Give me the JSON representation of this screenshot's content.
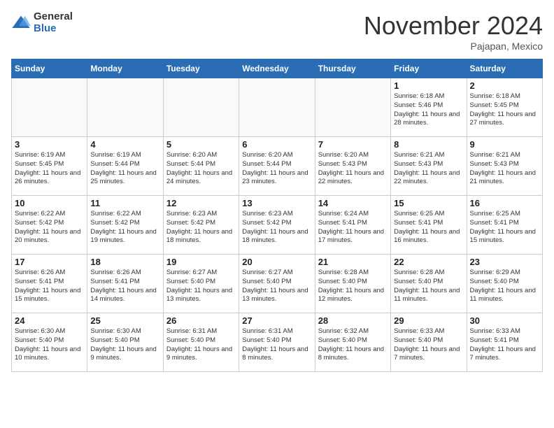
{
  "header": {
    "logo_general": "General",
    "logo_blue": "Blue",
    "month_title": "November 2024",
    "location": "Pajapan, Mexico"
  },
  "weekdays": [
    "Sunday",
    "Monday",
    "Tuesday",
    "Wednesday",
    "Thursday",
    "Friday",
    "Saturday"
  ],
  "weeks": [
    [
      {
        "day": "",
        "sunrise": "",
        "sunset": "",
        "daylight": ""
      },
      {
        "day": "",
        "sunrise": "",
        "sunset": "",
        "daylight": ""
      },
      {
        "day": "",
        "sunrise": "",
        "sunset": "",
        "daylight": ""
      },
      {
        "day": "",
        "sunrise": "",
        "sunset": "",
        "daylight": ""
      },
      {
        "day": "",
        "sunrise": "",
        "sunset": "",
        "daylight": ""
      },
      {
        "day": "1",
        "sunrise": "Sunrise: 6:18 AM",
        "sunset": "Sunset: 5:46 PM",
        "daylight": "Daylight: 11 hours and 28 minutes."
      },
      {
        "day": "2",
        "sunrise": "Sunrise: 6:18 AM",
        "sunset": "Sunset: 5:45 PM",
        "daylight": "Daylight: 11 hours and 27 minutes."
      }
    ],
    [
      {
        "day": "3",
        "sunrise": "Sunrise: 6:19 AM",
        "sunset": "Sunset: 5:45 PM",
        "daylight": "Daylight: 11 hours and 26 minutes."
      },
      {
        "day": "4",
        "sunrise": "Sunrise: 6:19 AM",
        "sunset": "Sunset: 5:44 PM",
        "daylight": "Daylight: 11 hours and 25 minutes."
      },
      {
        "day": "5",
        "sunrise": "Sunrise: 6:20 AM",
        "sunset": "Sunset: 5:44 PM",
        "daylight": "Daylight: 11 hours and 24 minutes."
      },
      {
        "day": "6",
        "sunrise": "Sunrise: 6:20 AM",
        "sunset": "Sunset: 5:44 PM",
        "daylight": "Daylight: 11 hours and 23 minutes."
      },
      {
        "day": "7",
        "sunrise": "Sunrise: 6:20 AM",
        "sunset": "Sunset: 5:43 PM",
        "daylight": "Daylight: 11 hours and 22 minutes."
      },
      {
        "day": "8",
        "sunrise": "Sunrise: 6:21 AM",
        "sunset": "Sunset: 5:43 PM",
        "daylight": "Daylight: 11 hours and 22 minutes."
      },
      {
        "day": "9",
        "sunrise": "Sunrise: 6:21 AM",
        "sunset": "Sunset: 5:43 PM",
        "daylight": "Daylight: 11 hours and 21 minutes."
      }
    ],
    [
      {
        "day": "10",
        "sunrise": "Sunrise: 6:22 AM",
        "sunset": "Sunset: 5:42 PM",
        "daylight": "Daylight: 11 hours and 20 minutes."
      },
      {
        "day": "11",
        "sunrise": "Sunrise: 6:22 AM",
        "sunset": "Sunset: 5:42 PM",
        "daylight": "Daylight: 11 hours and 19 minutes."
      },
      {
        "day": "12",
        "sunrise": "Sunrise: 6:23 AM",
        "sunset": "Sunset: 5:42 PM",
        "daylight": "Daylight: 11 hours and 18 minutes."
      },
      {
        "day": "13",
        "sunrise": "Sunrise: 6:23 AM",
        "sunset": "Sunset: 5:42 PM",
        "daylight": "Daylight: 11 hours and 18 minutes."
      },
      {
        "day": "14",
        "sunrise": "Sunrise: 6:24 AM",
        "sunset": "Sunset: 5:41 PM",
        "daylight": "Daylight: 11 hours and 17 minutes."
      },
      {
        "day": "15",
        "sunrise": "Sunrise: 6:25 AM",
        "sunset": "Sunset: 5:41 PM",
        "daylight": "Daylight: 11 hours and 16 minutes."
      },
      {
        "day": "16",
        "sunrise": "Sunrise: 6:25 AM",
        "sunset": "Sunset: 5:41 PM",
        "daylight": "Daylight: 11 hours and 15 minutes."
      }
    ],
    [
      {
        "day": "17",
        "sunrise": "Sunrise: 6:26 AM",
        "sunset": "Sunset: 5:41 PM",
        "daylight": "Daylight: 11 hours and 15 minutes."
      },
      {
        "day": "18",
        "sunrise": "Sunrise: 6:26 AM",
        "sunset": "Sunset: 5:41 PM",
        "daylight": "Daylight: 11 hours and 14 minutes."
      },
      {
        "day": "19",
        "sunrise": "Sunrise: 6:27 AM",
        "sunset": "Sunset: 5:40 PM",
        "daylight": "Daylight: 11 hours and 13 minutes."
      },
      {
        "day": "20",
        "sunrise": "Sunrise: 6:27 AM",
        "sunset": "Sunset: 5:40 PM",
        "daylight": "Daylight: 11 hours and 13 minutes."
      },
      {
        "day": "21",
        "sunrise": "Sunrise: 6:28 AM",
        "sunset": "Sunset: 5:40 PM",
        "daylight": "Daylight: 11 hours and 12 minutes."
      },
      {
        "day": "22",
        "sunrise": "Sunrise: 6:28 AM",
        "sunset": "Sunset: 5:40 PM",
        "daylight": "Daylight: 11 hours and 11 minutes."
      },
      {
        "day": "23",
        "sunrise": "Sunrise: 6:29 AM",
        "sunset": "Sunset: 5:40 PM",
        "daylight": "Daylight: 11 hours and 11 minutes."
      }
    ],
    [
      {
        "day": "24",
        "sunrise": "Sunrise: 6:30 AM",
        "sunset": "Sunset: 5:40 PM",
        "daylight": "Daylight: 11 hours and 10 minutes."
      },
      {
        "day": "25",
        "sunrise": "Sunrise: 6:30 AM",
        "sunset": "Sunset: 5:40 PM",
        "daylight": "Daylight: 11 hours and 9 minutes."
      },
      {
        "day": "26",
        "sunrise": "Sunrise: 6:31 AM",
        "sunset": "Sunset: 5:40 PM",
        "daylight": "Daylight: 11 hours and 9 minutes."
      },
      {
        "day": "27",
        "sunrise": "Sunrise: 6:31 AM",
        "sunset": "Sunset: 5:40 PM",
        "daylight": "Daylight: 11 hours and 8 minutes."
      },
      {
        "day": "28",
        "sunrise": "Sunrise: 6:32 AM",
        "sunset": "Sunset: 5:40 PM",
        "daylight": "Daylight: 11 hours and 8 minutes."
      },
      {
        "day": "29",
        "sunrise": "Sunrise: 6:33 AM",
        "sunset": "Sunset: 5:40 PM",
        "daylight": "Daylight: 11 hours and 7 minutes."
      },
      {
        "day": "30",
        "sunrise": "Sunrise: 6:33 AM",
        "sunset": "Sunset: 5:41 PM",
        "daylight": "Daylight: 11 hours and 7 minutes."
      }
    ]
  ]
}
